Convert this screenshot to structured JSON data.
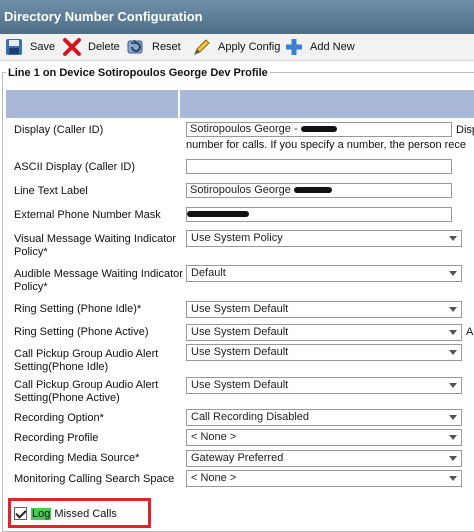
{
  "window": {
    "title": "Directory Number Configuration"
  },
  "toolbar": {
    "save": "Save",
    "delete": "Delete",
    "reset": "Reset",
    "apply_config": "Apply Config",
    "add_new": "Add New"
  },
  "section": {
    "legend": "Line 1 on Device Sotiropoulos George Dev Profile"
  },
  "fields": {
    "display": {
      "label": "Display (Caller ID)",
      "value": "Sotiropoulos George -",
      "hint_right": "Disp",
      "hint_below": "number for calls. If you specify a number, the person rece"
    },
    "ascii_display": {
      "label": "ASCII Display (Caller ID)",
      "value": ""
    },
    "line_text_label": {
      "label": "Line Text Label",
      "value": "Sotiropoulos George"
    },
    "external_mask": {
      "label": "External Phone Number Mask",
      "value": ""
    },
    "visual_mwi": {
      "label": "Visual Message Waiting Indicator Policy",
      "required": "*",
      "value": "Use System Policy"
    },
    "audible_mwi": {
      "label": "Audible Message Waiting Indicator Policy",
      "required": "*",
      "value": "Default"
    },
    "ring_idle": {
      "label": "Ring Setting (Phone Idle)",
      "required": "*",
      "value": "Use System Default"
    },
    "ring_active": {
      "label": "Ring Setting (Phone Active)",
      "value": "Use System Default",
      "hint_right": "A"
    },
    "pickup_idle": {
      "label": "Call Pickup Group Audio Alert Setting(Phone Idle)",
      "value": "Use System Default"
    },
    "pickup_active": {
      "label": "Call Pickup Group Audio Alert Setting(Phone Active)",
      "value": "Use System Default"
    },
    "recording_option": {
      "label": "Recording Option",
      "required": "*",
      "value": "Call Recording Disabled"
    },
    "recording_profile": {
      "label": "Recording Profile",
      "value": "< None >"
    },
    "recording_media": {
      "label": "Recording Media Source",
      "required": "*",
      "value": "Gateway Preferred"
    },
    "monitoring_css": {
      "label": "Monitoring Calling Search Space",
      "value": "< None >"
    },
    "log_missed": {
      "highlight": "Log",
      "label": "Missed Calls",
      "checked": true
    }
  },
  "colors": {
    "header_band": "#a9b8d6",
    "highlight_box": "#e0242a",
    "log_highlight": "#3fd24a"
  }
}
